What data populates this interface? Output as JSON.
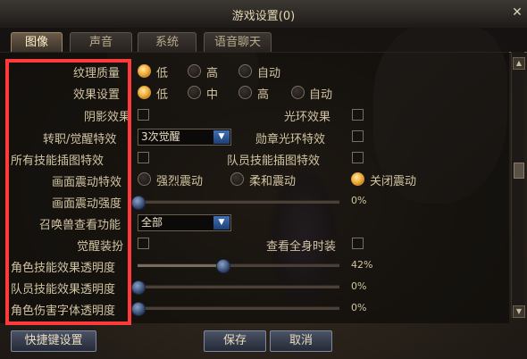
{
  "window": {
    "title": "游戏设置(0)",
    "close": "✕"
  },
  "tabs": [
    "图像",
    "声音",
    "系统",
    "语音聊天"
  ],
  "settings": {
    "texture_quality": {
      "label": "纹理质量",
      "options": [
        "低",
        "高",
        "自动"
      ],
      "selected": "低"
    },
    "effect_setting": {
      "label": "效果设置",
      "options": [
        "低",
        "中",
        "高",
        "自动"
      ],
      "selected": "低"
    },
    "shadow_effect": {
      "label": "阴影效果",
      "checked": false
    },
    "halo_effect": {
      "label": "光环效果",
      "checked": false
    },
    "awakening_effect": {
      "label": "转职/觉醒特效",
      "value": "3次觉醒"
    },
    "medal_halo_effect": {
      "label": "勋章光环特效",
      "checked": false
    },
    "all_skill_cutin": {
      "label": "所有技能插图特效",
      "checked": false
    },
    "party_skill_cutin": {
      "label": "队员技能插图特效",
      "checked": false
    },
    "screen_shake": {
      "label": "画面震动特效",
      "options": [
        "强烈震动",
        "柔和震动",
        "关闭震动"
      ],
      "selected": "关闭震动"
    },
    "screen_shake_strength": {
      "label": "画面震动强度",
      "value": "0%",
      "level": 0
    },
    "summon_view": {
      "label": "召唤兽查看功能",
      "value": "全部"
    },
    "awakening_outfit": {
      "label": "觉醒装扮",
      "checked": false
    },
    "view_fullbody_outfit": {
      "label": "查看全身时装",
      "checked": false
    },
    "char_skill_opacity": {
      "label": "角色技能效果透明度",
      "value": "42%",
      "level": 0.42
    },
    "party_skill_opacity": {
      "label": "队员技能效果透明度",
      "value": "0%",
      "level": 0
    },
    "char_damage_font_opacity": {
      "label": "角色伤害字体透明度",
      "value": "0%",
      "level": 0
    }
  },
  "buttons": {
    "shortcut": "快捷键设置",
    "save": "保存",
    "cancel": "取消"
  },
  "icons": {
    "dropdown": "▼",
    "scroll_up": "▲",
    "scroll_down": "▼"
  },
  "colors": {
    "highlight": "#ff3a3a",
    "radio_on": "#f0a830",
    "slider_knob": "#2c3f66"
  }
}
